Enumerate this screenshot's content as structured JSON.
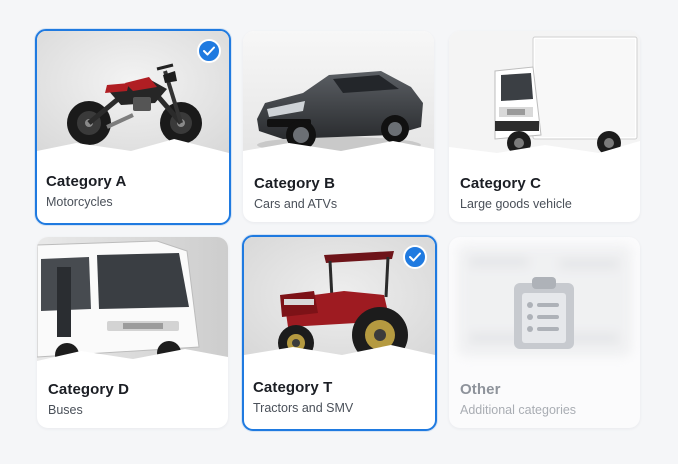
{
  "categories": [
    {
      "title": "Category A",
      "subtitle": "Motorcycles",
      "selected": true
    },
    {
      "title": "Category B",
      "subtitle": "Cars and ATVs",
      "selected": false
    },
    {
      "title": "Category C",
      "subtitle": "Large goods vehicle",
      "selected": false
    },
    {
      "title": "Category D",
      "subtitle": "Buses",
      "selected": false
    },
    {
      "title": "Category T",
      "subtitle": "Tractors and SMV",
      "selected": true
    },
    {
      "title": "Other",
      "subtitle": "Additional categories",
      "selected": false,
      "disabled": true
    }
  ],
  "icons": {
    "selected": "checkmark-icon",
    "other": "clipboard-list-icon"
  },
  "colors": {
    "accent": "#1f7ae0",
    "title": "#1b1e24",
    "subtitle": "#4a5059",
    "disabled_text": "#8e939b"
  }
}
